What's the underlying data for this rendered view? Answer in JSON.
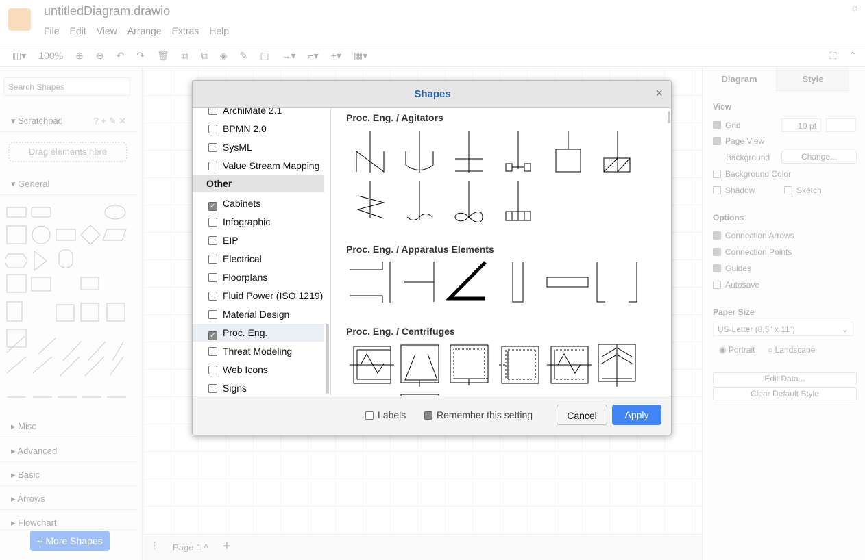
{
  "app": {
    "title": "untitledDiagram.drawio",
    "menu": [
      "File",
      "Edit",
      "View",
      "Arrange",
      "Extras",
      "Help"
    ],
    "zoom": "100%"
  },
  "sidebar": {
    "search_placeholder": "Search Shapes",
    "scratchpad": "Scratchpad",
    "scratch_icons": "? + ✎ ✕",
    "drag_hint": "Drag elements here",
    "general": "General",
    "sections": [
      "Misc",
      "Advanced",
      "Basic",
      "Arrows",
      "Flowchart"
    ],
    "more_shapes": "+ More Shapes"
  },
  "pagebar": {
    "page": "Page-1 ^",
    "add": "+"
  },
  "format": {
    "tabs": [
      "Diagram",
      "Style"
    ],
    "view": "View",
    "grid": "Grid",
    "grid_size": "10 pt",
    "page_view": "Page View",
    "background": "Background",
    "change": "Change...",
    "background_color": "Background Color",
    "shadow": "Shadow",
    "sketch": "Sketch",
    "options": "Options",
    "connection_arrows": "Connection Arrows",
    "connection_points": "Connection Points",
    "guides": "Guides",
    "autosave": "Autosave",
    "paper_size": "Paper Size",
    "paper_value": "US-Letter (8,5\" x 11\")",
    "portrait": "Portrait",
    "landscape": "Landscape",
    "edit_data": "Edit Data...",
    "clear_style": "Clear Default Style"
  },
  "dialog": {
    "title": "Shapes",
    "close": "×",
    "items_top": [
      {
        "label": "ArchiMate 2.1",
        "checked": false
      },
      {
        "label": "BPMN 2.0",
        "checked": false
      },
      {
        "label": "SysML",
        "checked": false
      },
      {
        "label": "Value Stream Mapping",
        "checked": false
      }
    ],
    "group": "Other",
    "items": [
      {
        "label": "Cabinets",
        "checked": true
      },
      {
        "label": "Infographic",
        "checked": false
      },
      {
        "label": "EIP",
        "checked": false
      },
      {
        "label": "Electrical",
        "checked": false
      },
      {
        "label": "Floorplans",
        "checked": false
      },
      {
        "label": "Fluid Power (ISO 1219)",
        "checked": false
      },
      {
        "label": "Material Design",
        "checked": false
      },
      {
        "label": "Proc. Eng.",
        "checked": true,
        "selected": true
      },
      {
        "label": "Threat Modeling",
        "checked": false
      },
      {
        "label": "Web Icons",
        "checked": false
      },
      {
        "label": "Signs",
        "checked": false
      }
    ],
    "sections": [
      "Proc. Eng. / Agitators",
      "Proc. Eng. / Apparatus Elements",
      "Proc. Eng. / Centrifuges"
    ],
    "labels": "Labels",
    "labels_checked": false,
    "remember": "Remember this setting",
    "remember_checked": true,
    "cancel": "Cancel",
    "apply": "Apply",
    "accent": "#4285f4"
  }
}
